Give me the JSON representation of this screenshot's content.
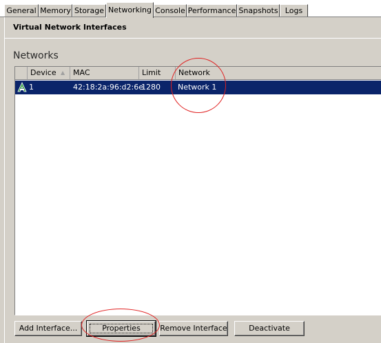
{
  "tabs": [
    {
      "label": "General",
      "active": false
    },
    {
      "label": "Memory",
      "active": false
    },
    {
      "label": "Storage",
      "active": false
    },
    {
      "label": "Networking",
      "active": true
    },
    {
      "label": "Console",
      "active": false
    },
    {
      "label": "Performance",
      "active": false
    },
    {
      "label": "Snapshots",
      "active": false
    },
    {
      "label": "Logs",
      "active": false
    }
  ],
  "section": {
    "heading": "Virtual Network Interfaces",
    "group_title": "Networks"
  },
  "table": {
    "columns": [
      "Device",
      "MAC",
      "Limit",
      "Network"
    ],
    "sort_column": "Device",
    "sort_direction": "ascending",
    "rows": [
      {
        "device": "1",
        "mac": "42:18:2a:96:d2:6e",
        "limit": "1280",
        "network": "Network 1",
        "selected": true,
        "icon": "network-interface-icon"
      }
    ]
  },
  "buttons": {
    "add_interface": "Add Interface...",
    "properties": "Properties",
    "remove_interface": "Remove Interface",
    "deactivate": "Deactivate"
  },
  "colors": {
    "selection": "#0a246a",
    "annotation_circle": "#e02020",
    "window_bg": "#d4d0c8"
  }
}
